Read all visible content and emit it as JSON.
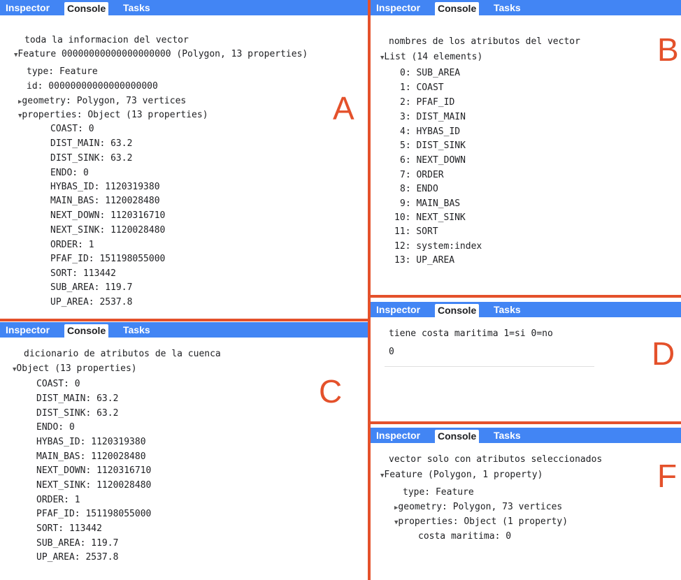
{
  "tabs": {
    "inspector": "Inspector",
    "console": "Console",
    "tasks": "Tasks"
  },
  "panelA": {
    "letter": "A",
    "lines": [
      "toda la informacion del vector",
      "Feature 00000000000000000000 (Polygon, 13 properties)",
      "type: Feature",
      "id: 00000000000000000000",
      "geometry: Polygon, 73 vertices",
      "properties: Object (13 properties)",
      "COAST: 0",
      "DIST_MAIN: 63.2",
      "DIST_SINK: 63.2",
      "ENDO: 0",
      "HYBAS_ID: 1120319380",
      "MAIN_BAS: 1120028480",
      "NEXT_DOWN: 1120316710",
      "NEXT_SINK: 1120028480",
      "ORDER: 1",
      "PFAF_ID: 151198055000",
      "SORT: 113442",
      "SUB_AREA: 119.7",
      "UP_AREA: 2537.8"
    ]
  },
  "panelB": {
    "letter": "B",
    "lines": [
      "nombres de los atributos del vector",
      "List (14 elements)",
      "0: SUB_AREA",
      "1: COAST",
      "2: PFAF_ID",
      "3: DIST_MAIN",
      "4: HYBAS_ID",
      "5: DIST_SINK",
      "6: NEXT_DOWN",
      "7: ORDER",
      "8: ENDO",
      "9: MAIN_BAS",
      "10: NEXT_SINK",
      "11: SORT",
      "12: system:index",
      "13: UP_AREA"
    ]
  },
  "panelC": {
    "letter": "C",
    "lines": [
      "dicionario de atributos de la cuenca",
      "Object (13 properties)",
      "COAST: 0",
      "DIST_MAIN: 63.2",
      "DIST_SINK: 63.2",
      "ENDO: 0",
      "HYBAS_ID: 1120319380",
      "MAIN_BAS: 1120028480",
      "NEXT_DOWN: 1120316710",
      "NEXT_SINK: 1120028480",
      "ORDER: 1",
      "PFAF_ID: 151198055000",
      "SORT: 113442",
      "SUB_AREA: 119.7",
      "UP_AREA: 2537.8"
    ]
  },
  "panelD": {
    "letter": "D",
    "lines": [
      "tiene costa maritima 1=si 0=no",
      "0"
    ]
  },
  "panelF": {
    "letter": "F",
    "lines": [
      "vector solo con atributos seleccionados",
      "Feature (Polygon, 1 property)",
      "type: Feature",
      "geometry: Polygon, 73 vertices",
      "properties: Object (1 property)",
      "costa maritima: 0"
    ]
  },
  "colors": {
    "tabbar": "#4285f4",
    "divider": "#e4512b",
    "letter": "#e4512b"
  }
}
